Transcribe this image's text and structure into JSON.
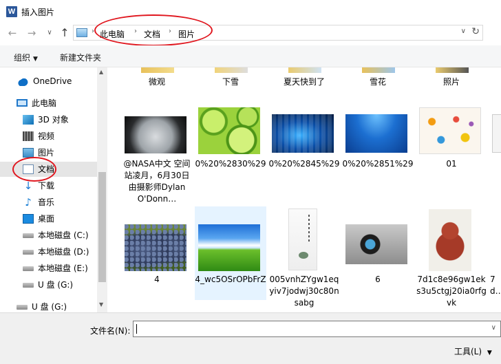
{
  "window": {
    "title": "插入图片",
    "app_icon_letter": "W"
  },
  "address": {
    "crumbs": [
      "此电脑",
      "文档",
      "图片"
    ],
    "separator": "›"
  },
  "toolbar": {
    "organize_label": "组织",
    "new_folder_label": "新建文件夹"
  },
  "nav": {
    "items": [
      {
        "label": "OneDrive",
        "icon": "onedrive-icon"
      },
      {
        "label": "此电脑",
        "icon": "computer-icon"
      },
      {
        "label": "3D 对象",
        "icon": "3d-objects-icon"
      },
      {
        "label": "视频",
        "icon": "videos-icon"
      },
      {
        "label": "图片",
        "icon": "pictures-icon"
      },
      {
        "label": "文档",
        "icon": "documents-icon"
      },
      {
        "label": "下载",
        "icon": "download-icon"
      },
      {
        "label": "音乐",
        "icon": "music-icon"
      },
      {
        "label": "桌面",
        "icon": "desktop-icon"
      },
      {
        "label": "本地磁盘 (C:)",
        "icon": "drive-icon"
      },
      {
        "label": "本地磁盘 (D:)",
        "icon": "drive-icon"
      },
      {
        "label": "本地磁盘 (E:)",
        "icon": "drive-icon"
      },
      {
        "label": "U 盘 (G:)",
        "icon": "drive-icon"
      },
      {
        "label": "U 盘 (G:)",
        "icon": "drive-icon"
      }
    ]
  },
  "folders_top": [
    "微观",
    "下雪",
    "夏天快到了",
    "雪花",
    "照片"
  ],
  "files_row1": [
    {
      "name": "@NASA中文 空间站凌月，6月30日由摄影师Dylan O'Donn…",
      "thumb": "moon"
    },
    {
      "name": "0%20%2830%29",
      "thumb": "limes"
    },
    {
      "name": "0%20%2845%29",
      "thumb": "blue-tiles"
    },
    {
      "name": "0%20%2851%29",
      "thumb": "blue-wave"
    },
    {
      "name": "01",
      "thumb": "collage"
    }
  ],
  "files_row2": [
    {
      "name": "4",
      "thumb": "grapes"
    },
    {
      "name": "4_wc5OSrOPbFrZ",
      "thumb": "meadow"
    },
    {
      "name": "005vnhZYgw1eqyiv7jodwj30c80nsabg",
      "thumb": "ink"
    },
    {
      "name": "6",
      "thumb": "screen"
    },
    {
      "name": "7d1c8e96gw1eks3u5ctgj20ia0rfgvk",
      "thumb": "octopus"
    },
    {
      "name": "7d…",
      "thumb": "none"
    }
  ],
  "filename": {
    "label": "文件名(N):",
    "value": ""
  },
  "tools_label": "工具(L)",
  "colors": {
    "annotation_red": "#e0161e",
    "selection": "#e5f3ff",
    "toolbar_bg": "#f5f6f7"
  }
}
